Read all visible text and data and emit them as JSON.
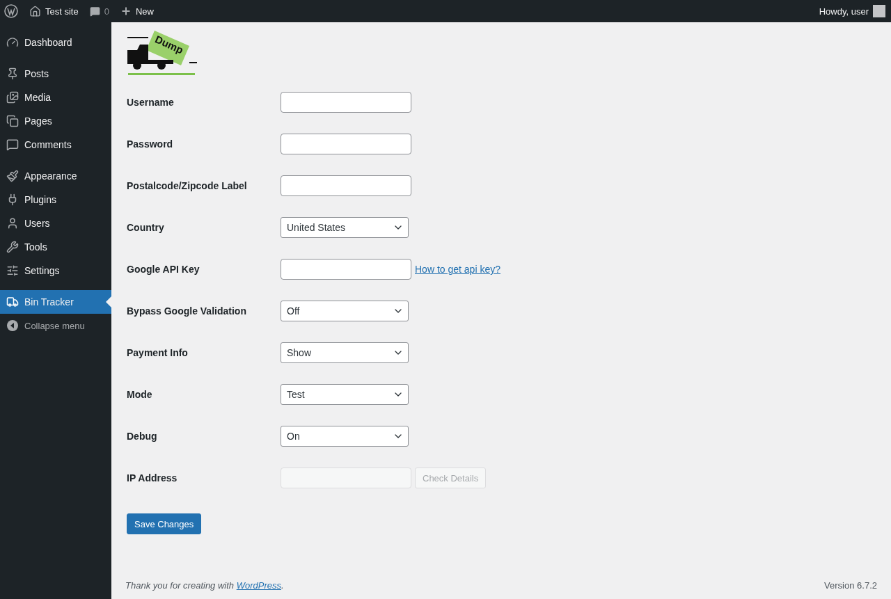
{
  "admin_bar": {
    "site": "Test site",
    "comments_count": "0",
    "new_label": "New",
    "greeting": "Howdy, user"
  },
  "sidebar": {
    "groups": [
      {
        "items": [
          {
            "label": "Dashboard",
            "selected": false
          }
        ]
      },
      {
        "items": [
          {
            "label": "Posts",
            "selected": false
          },
          {
            "label": "Media",
            "selected": false
          },
          {
            "label": "Pages",
            "selected": false
          },
          {
            "label": "Comments",
            "selected": false
          }
        ]
      },
      {
        "items": [
          {
            "label": "Appearance",
            "selected": false
          },
          {
            "label": "Plugins",
            "selected": false
          },
          {
            "label": "Users",
            "selected": false
          },
          {
            "label": "Tools",
            "selected": false
          },
          {
            "label": "Settings",
            "selected": false
          }
        ]
      },
      {
        "items": [
          {
            "label": "Bin Tracker",
            "selected": true
          }
        ]
      }
    ],
    "collapse_label": "Collapse menu"
  },
  "logo": {
    "main": "Dump"
  },
  "fields": [
    {
      "label": "Username",
      "kind": "text"
    },
    {
      "label": "Password",
      "kind": "text"
    },
    {
      "label": "Postalcode/Zipcode Label",
      "kind": "text"
    },
    {
      "label": "Country",
      "kind": "select",
      "value": "United States"
    },
    {
      "label": "Google API Key",
      "kind": "text",
      "link": "How to get api key?"
    },
    {
      "label": "Bypass Google Validation",
      "kind": "select",
      "value": "Off"
    },
    {
      "label": "Payment Info",
      "kind": "select",
      "value": "Show"
    },
    {
      "label": "Mode",
      "kind": "select",
      "value": "Test"
    },
    {
      "label": "Debug",
      "kind": "select",
      "value": "On"
    },
    {
      "label": "IP Address",
      "kind": "text",
      "disabled": true,
      "button": "Check Details"
    }
  ],
  "save_button": "Save Changes",
  "footer": {
    "text_before": "Thank you for creating with ",
    "link": "WordPress",
    "text_after": ".",
    "version": "Version 6.7.2"
  }
}
